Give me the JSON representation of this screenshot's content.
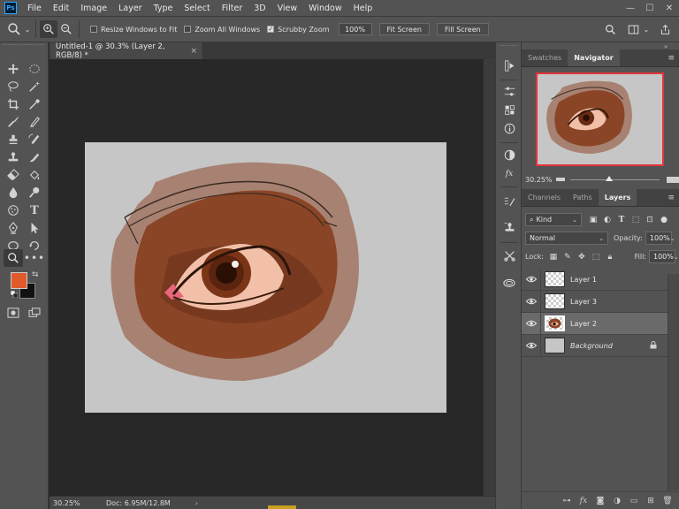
{
  "app": {
    "logo": "Ps"
  },
  "menu": [
    "File",
    "Edit",
    "Image",
    "Layer",
    "Type",
    "Select",
    "Filter",
    "3D",
    "View",
    "Window",
    "Help"
  ],
  "window_controls": {
    "minimize": "—",
    "maximize": "☐",
    "close": "✕"
  },
  "options": {
    "resize_windows": {
      "label": "Resize Windows to Fit",
      "checked": false
    },
    "zoom_all": {
      "label": "Zoom All Windows",
      "checked": false
    },
    "scrubby_zoom": {
      "label": "Scrubby Zoom",
      "checked": true
    },
    "zoom_value": "100%",
    "fit_screen": "Fit Screen",
    "fill_screen": "Fill Screen"
  },
  "document": {
    "tab_title": "Untitled-1 @ 30.3% (Layer 2, RGB/8) *",
    "close": "×"
  },
  "status": {
    "zoom": "30.25%",
    "doc": "Doc: 6.95M/12.8M",
    "arrow": "›"
  },
  "colors": {
    "foreground": "#e05a2b",
    "background": "#111111",
    "accent": "#31a8ff",
    "nav_frame": "#e0353b"
  },
  "panels": {
    "top_tabs": [
      "Swatches",
      "Navigator"
    ],
    "top_active": "Navigator",
    "navigator": {
      "zoom": "30.25%",
      "slider_fraction": 0.42
    },
    "layer_tabs": [
      "Channels",
      "Paths",
      "Layers"
    ],
    "layer_active": "Layers",
    "filter": {
      "kind": "Kind"
    },
    "blend_mode": "Normal",
    "opacity": {
      "label": "Opacity:",
      "value": "100%"
    },
    "lock": {
      "label": "Lock:"
    },
    "fill": {
      "label": "Fill:",
      "value": "100%"
    },
    "layers": [
      {
        "name": "Layer 1",
        "visible": true,
        "selected": false
      },
      {
        "name": "Layer 3",
        "visible": true,
        "selected": false
      },
      {
        "name": "Layer 2",
        "visible": true,
        "selected": true
      },
      {
        "name": "Background",
        "visible": true,
        "selected": false,
        "locked": true
      }
    ]
  }
}
